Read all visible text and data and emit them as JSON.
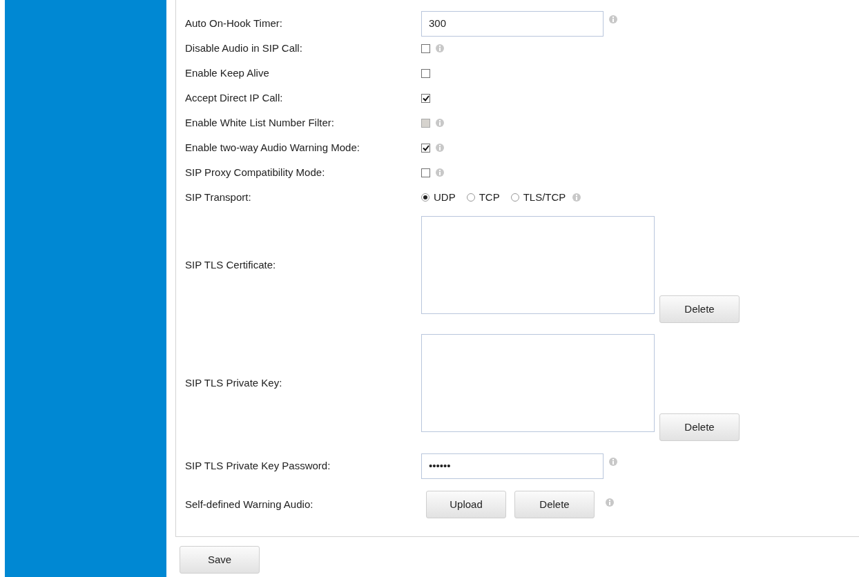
{
  "settings": [
    {
      "kind": "text",
      "label": "Auto On-Hook Timer:",
      "value": "300",
      "info": true
    },
    {
      "kind": "checkbox",
      "label": "Disable Audio in SIP Call:",
      "checked": false,
      "disabled": false,
      "info": true
    },
    {
      "kind": "checkbox",
      "label": "Enable Keep Alive",
      "checked": false,
      "disabled": false,
      "info": false
    },
    {
      "kind": "checkbox",
      "label": "Accept Direct IP Call:",
      "checked": true,
      "disabled": false,
      "info": false
    },
    {
      "kind": "checkbox",
      "label": "Enable White List Number Filter:",
      "checked": false,
      "disabled": true,
      "info": true
    },
    {
      "kind": "checkbox",
      "label": "Enable two-way Audio Warning Mode:",
      "checked": true,
      "disabled": false,
      "info": true
    },
    {
      "kind": "checkbox",
      "label": "SIP Proxy Compatibility Mode:",
      "checked": false,
      "disabled": false,
      "info": true
    },
    {
      "kind": "radio",
      "label": "SIP Transport:",
      "info": true,
      "options": [
        {
          "label": "UDP",
          "selected": true
        },
        {
          "label": "TCP",
          "selected": false
        },
        {
          "label": "TLS/TCP",
          "selected": false
        }
      ]
    },
    {
      "kind": "textarea",
      "label": "SIP TLS Certificate:",
      "button": "Delete"
    },
    {
      "kind": "textarea",
      "label": "SIP TLS Private Key:",
      "button": "Delete"
    },
    {
      "kind": "password",
      "label": "SIP TLS Private Key Password:",
      "value": "••••••",
      "info": true
    },
    {
      "kind": "buttons",
      "label": "Self-defined Warning Audio:",
      "buttons": [
        "Upload",
        "Delete"
      ],
      "info": true
    }
  ],
  "save_button": "Save"
}
